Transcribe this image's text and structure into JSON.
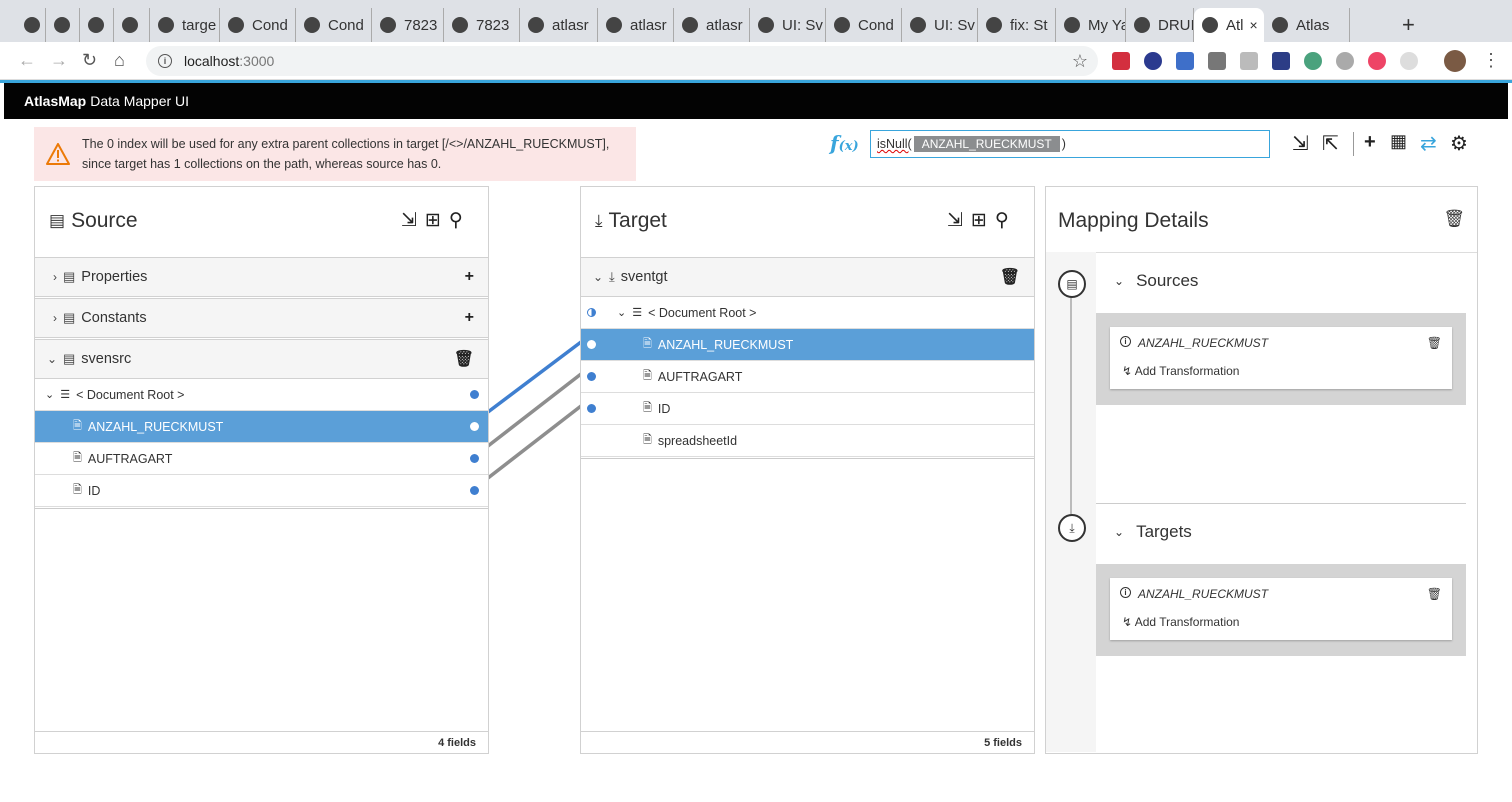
{
  "browser": {
    "tabs": [
      {
        "title": "",
        "icon": "gmail-icon"
      },
      {
        "title": "",
        "icon": "calendar-icon"
      },
      {
        "title": "",
        "icon": "maps-icon"
      },
      {
        "title": "",
        "icon": "app-icon"
      },
      {
        "title": "targe",
        "icon": "github-icon"
      },
      {
        "title": "Cond",
        "icon": "github-icon"
      },
      {
        "title": "Cond",
        "icon": "github-icon"
      },
      {
        "title": "7823",
        "icon": "globe-icon"
      },
      {
        "title": "7823",
        "icon": "globe-icon"
      },
      {
        "title": "atlasr",
        "icon": "github-icon"
      },
      {
        "title": "atlasr",
        "icon": "github-icon"
      },
      {
        "title": "atlasr",
        "icon": "github-icon"
      },
      {
        "title": "UI: Sv",
        "icon": "github-icon"
      },
      {
        "title": "Cond",
        "icon": "github-icon"
      },
      {
        "title": "UI: Sv",
        "icon": "github-icon"
      },
      {
        "title": "fix: St",
        "icon": "github-icon"
      },
      {
        "title": "My Ya",
        "icon": "yahoo-icon"
      },
      {
        "title": "DRUI",
        "icon": "drui-icon"
      },
      {
        "title": "Atl",
        "icon": "globe-icon",
        "active": true
      },
      {
        "title": "Atlas",
        "icon": "react-icon"
      }
    ],
    "url_host": "localhost",
    "url_port": ":3000"
  },
  "app": {
    "brand": "AtlasMap",
    "subtitle": "Data Mapper UI"
  },
  "alert": {
    "line1": "The 0 index will be used for any extra parent collections in target [/<>/ANZAHL_RUECKMUST],",
    "line2": "since target has 1 collections on the path, whereas source has 0."
  },
  "expression": {
    "fx_label": "f",
    "fx_sub": "(x)",
    "fn_text": "isNull(",
    "token": "ANZAHL_RUECKMUST",
    "close": ")"
  },
  "source": {
    "title": "Source",
    "groups": [
      {
        "label": "Properties"
      },
      {
        "label": "Constants"
      },
      {
        "label": "svensrc"
      }
    ],
    "root": "< Document Root >",
    "fields": [
      "ANZAHL_RUECKMUST",
      "AUFTRAGART",
      "ID"
    ],
    "footer": "4 fields"
  },
  "target": {
    "title": "Target",
    "group": "sventgt",
    "root": "< Document Root >",
    "fields": [
      "ANZAHL_RUECKMUST",
      "AUFTRAGART",
      "ID",
      "spreadsheetId"
    ],
    "footer": "5 fields"
  },
  "details": {
    "title": "Mapping Details",
    "sources_label": "Sources",
    "targets_label": "Targets",
    "source_field": "ANZAHL_RUECKMUST",
    "target_field": "ANZAHL_RUECKMUST",
    "add_transformation": "Add Transformation"
  },
  "colors": {
    "accent": "#39a5dc",
    "selected_row": "#5b9fd8",
    "line_active": "#3f7fd0",
    "line_inactive": "#8e8e8e",
    "alert_bg": "#fbe6e6"
  }
}
